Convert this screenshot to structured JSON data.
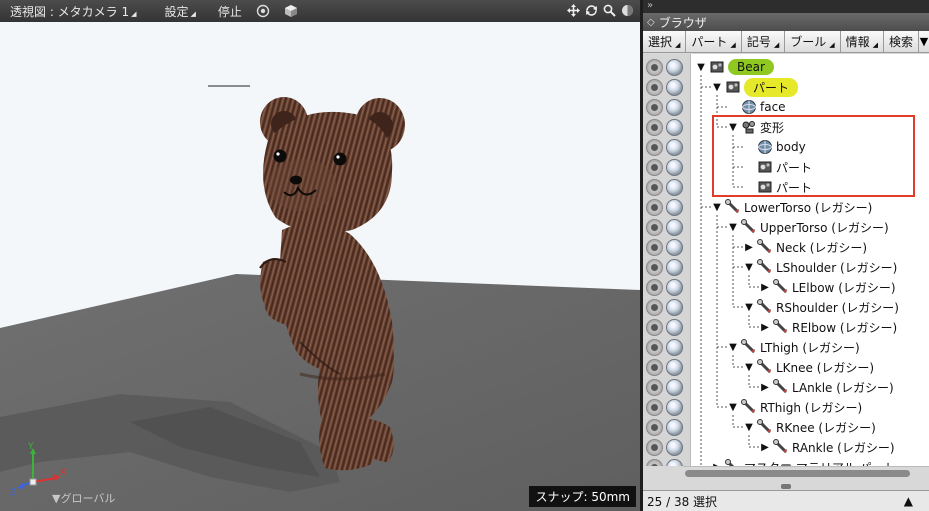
{
  "viewport": {
    "toolbar": {
      "view_label": "透視図 : メタカメラ 1",
      "settings_label": "設定",
      "stop_label": "停止"
    },
    "snap_label": "スナップ: 50mm",
    "global_label": "▼グローバル",
    "axes": {
      "y": "Y",
      "x": "X",
      "z": "Z"
    }
  },
  "browser": {
    "top_label": "»",
    "title": "ブラウザ",
    "tabs": [
      {
        "label": "選択"
      },
      {
        "label": "パート"
      },
      {
        "label": "記号"
      },
      {
        "label": "ブール"
      },
      {
        "label": "情報"
      },
      {
        "label": "検索"
      }
    ],
    "tree": [
      {
        "label": "Bear",
        "expander": "▼",
        "icon": "part-icon",
        "style": "pill-green"
      },
      {
        "label": "パート",
        "expander": "▼",
        "icon": "part-icon",
        "style": "pill-yellow"
      },
      {
        "label": "face",
        "expander": "",
        "icon": "sphere-icon",
        "style": ""
      },
      {
        "label": "変形",
        "expander": "▼",
        "icon": "deform-icon",
        "style": ""
      },
      {
        "label": "body",
        "expander": "",
        "icon": "sphere-icon",
        "style": ""
      },
      {
        "label": "パート",
        "expander": "",
        "icon": "part-icon",
        "style": ""
      },
      {
        "label": "パート",
        "expander": "",
        "icon": "part-icon",
        "style": ""
      },
      {
        "label": "LowerTorso (レガシー)",
        "expander": "▼",
        "icon": "bone-icon",
        "style": ""
      },
      {
        "label": "UpperTorso (レガシー)",
        "expander": "▼",
        "icon": "bone-icon",
        "style": ""
      },
      {
        "label": "Neck (レガシー)",
        "expander": "▶",
        "icon": "bone-icon",
        "style": ""
      },
      {
        "label": "LShoulder (レガシー)",
        "expander": "▼",
        "icon": "bone-icon",
        "style": ""
      },
      {
        "label": "LElbow (レガシー)",
        "expander": "▶",
        "icon": "bone-icon",
        "style": ""
      },
      {
        "label": "RShoulder (レガシー)",
        "expander": "▼",
        "icon": "bone-icon",
        "style": ""
      },
      {
        "label": "RElbow (レガシー)",
        "expander": "▶",
        "icon": "bone-icon",
        "style": ""
      },
      {
        "label": "LThigh (レガシー)",
        "expander": "▼",
        "icon": "bone-icon",
        "style": ""
      },
      {
        "label": "LKnee (レガシー)",
        "expander": "▼",
        "icon": "bone-icon",
        "style": ""
      },
      {
        "label": "LAnkle (レガシー)",
        "expander": "▶",
        "icon": "bone-icon",
        "style": ""
      },
      {
        "label": "RThigh (レガシー)",
        "expander": "▼",
        "icon": "bone-icon",
        "style": ""
      },
      {
        "label": "RKnee (レガシー)",
        "expander": "▼",
        "icon": "bone-icon",
        "style": ""
      },
      {
        "label": "RAnkle (レガシー)",
        "expander": "▶",
        "icon": "bone-icon",
        "style": ""
      },
      {
        "label": "マスター マテリアル パート",
        "expander": "▶",
        "icon": "bone-icon",
        "style": ""
      }
    ],
    "status": "25 / 38 選択"
  },
  "colors": {
    "selection_box": "#e03c2c",
    "bear_pill": "#8ec820",
    "part_pill": "#e6e82a",
    "floor": "#6e6e6e",
    "background": "#f4f7fa"
  }
}
